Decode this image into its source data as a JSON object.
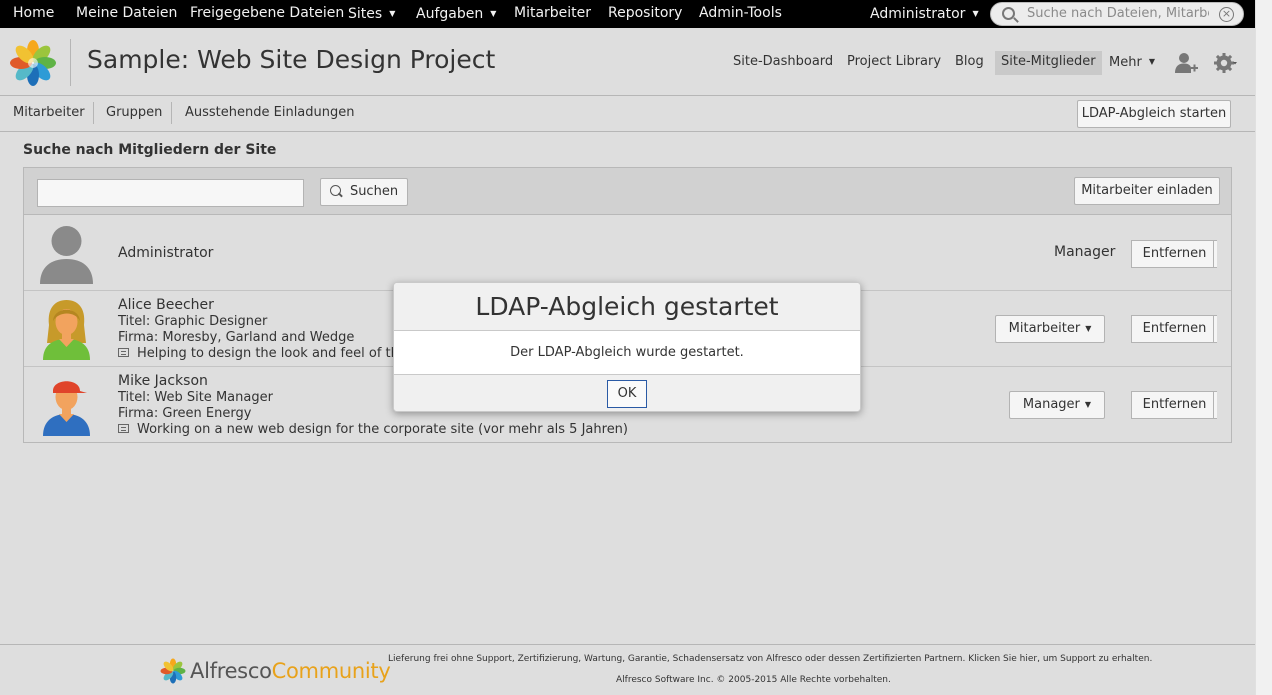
{
  "topnav": {
    "items": [
      "Home",
      "Meine Dateien",
      "Freigegebene Dateien",
      "Sites",
      "Aufgaben",
      "Mitarbeiter",
      "Repository",
      "Admin-Tools"
    ],
    "user": "Administrator",
    "search_placeholder": "Suche nach Dateien, Mitarbeit"
  },
  "site": {
    "title": "Sample: Web Site Design Project",
    "nav": [
      "Site-Dashboard",
      "Project Library",
      "Blog",
      "Site-Mitglieder",
      "Mehr"
    ],
    "active_nav": "Site-Mitglieder"
  },
  "subnav": {
    "items": [
      "Mitarbeiter",
      "Gruppen",
      "Ausstehende Einladungen"
    ],
    "ldap_button": "LDAP-Abgleich starten"
  },
  "members": {
    "section_title": "Suche nach Mitgliedern der Site",
    "search_value": "",
    "search_button": "Suchen",
    "invite_button": "Mitarbeiter einladen",
    "remove_label": "Entfernen",
    "rows": [
      {
        "name": "Administrator",
        "title": "",
        "company": "",
        "status": "",
        "role": "Manager"
      },
      {
        "name": "Alice Beecher",
        "title": "Titel:  Graphic Designer",
        "company": "Firma: Moresby, Garland and Wedge",
        "status": "Helping to design the look and feel of the",
        "role": "Mitarbeiter"
      },
      {
        "name": "Mike Jackson",
        "title": "Titel:  Web Site Manager",
        "company": "Firma: Green Energy",
        "status": "Working on a new web design for the corporate site (vor mehr als 5 Jahren)",
        "role": "Manager"
      }
    ]
  },
  "dialog": {
    "title": "LDAP-Abgleich gestartet",
    "message": "Der LDAP-Abgleich wurde gestartet.",
    "ok": "OK"
  },
  "footer": {
    "brand": "Alfresco",
    "brand_suffix": "Community",
    "notice": "Lieferung frei ohne Support, Zertifizierung, Wartung, Garantie, Schadensersatz von Alfresco oder dessen Zertifizierten Partnern. Klicken Sie hier, um Support zu erhalten.",
    "copyright": "Alfresco Software Inc. © 2005-2015 Alle Rechte vorbehalten."
  },
  "colors": {
    "topbar": "#000000",
    "page_bg": "#dedede",
    "toolbar_bg": "#d1d1d1",
    "dialog_focus": "#2a5aa5",
    "brand_orange": "#e8a21b"
  }
}
